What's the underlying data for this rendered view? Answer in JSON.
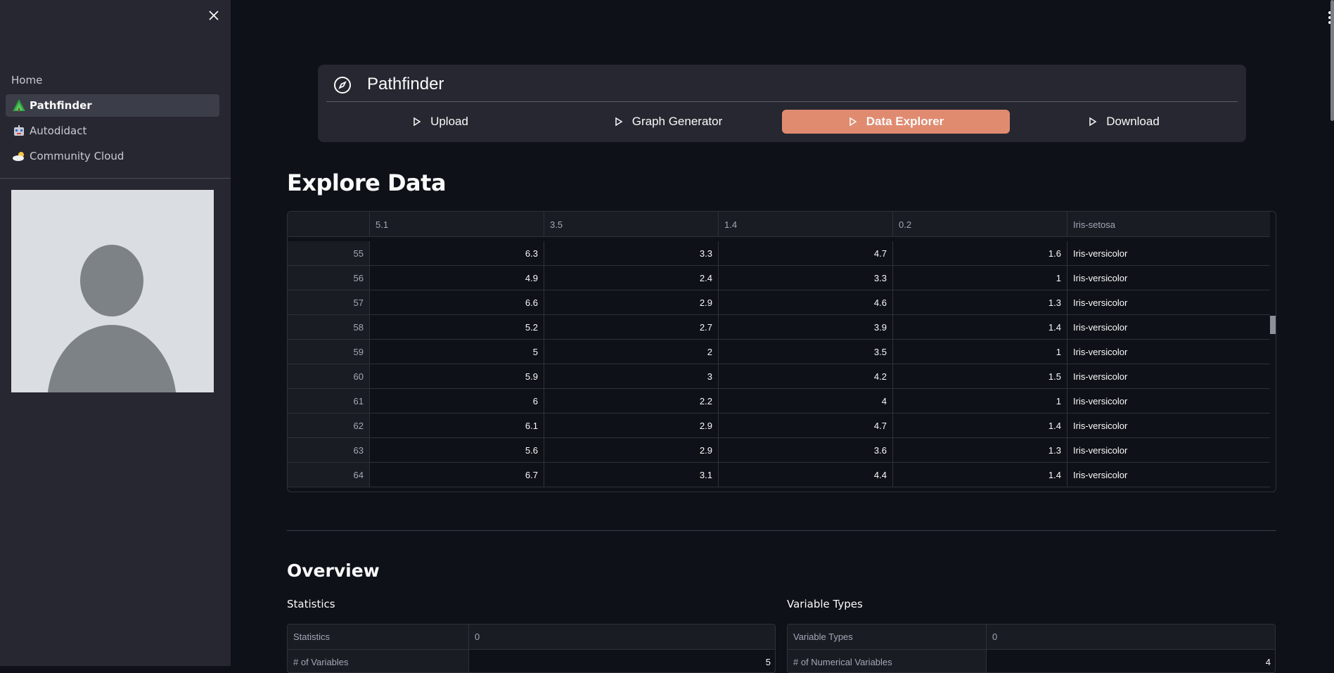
{
  "sidebar": {
    "close_icon": "close-icon",
    "items": [
      {
        "label": "Home",
        "icon": "",
        "active": false
      },
      {
        "label": "Pathfinder",
        "icon": "tree-icon",
        "active": true
      },
      {
        "label": "Autodidact",
        "icon": "robot-icon",
        "active": false
      },
      {
        "label": "Community Cloud",
        "icon": "cloud-sun-icon",
        "active": false
      }
    ],
    "avatar_icon": "user-avatar-icon"
  },
  "nav": {
    "title": "Pathfinder",
    "icon": "compass-icon",
    "tabs": [
      {
        "label": "Upload",
        "active": false
      },
      {
        "label": "Graph Generator",
        "active": false
      },
      {
        "label": "Data Explorer",
        "active": true
      },
      {
        "label": "Download",
        "active": false
      }
    ],
    "accent_color": "#e08b70"
  },
  "explore": {
    "title": "Explore Data",
    "columns": [
      "",
      "5.1",
      "3.5",
      "1.4",
      "0.2",
      "Iris-setosa"
    ],
    "rows": [
      [
        "55",
        "6.3",
        "3.3",
        "4.7",
        "1.6",
        "Iris-versicolor"
      ],
      [
        "56",
        "4.9",
        "2.4",
        "3.3",
        "1",
        "Iris-versicolor"
      ],
      [
        "57",
        "6.6",
        "2.9",
        "4.6",
        "1.3",
        "Iris-versicolor"
      ],
      [
        "58",
        "5.2",
        "2.7",
        "3.9",
        "1.4",
        "Iris-versicolor"
      ],
      [
        "59",
        "5",
        "2",
        "3.5",
        "1",
        "Iris-versicolor"
      ],
      [
        "60",
        "5.9",
        "3",
        "4.2",
        "1.5",
        "Iris-versicolor"
      ],
      [
        "61",
        "6",
        "2.2",
        "4",
        "1",
        "Iris-versicolor"
      ],
      [
        "62",
        "6.1",
        "2.9",
        "4.7",
        "1.4",
        "Iris-versicolor"
      ],
      [
        "63",
        "5.6",
        "2.9",
        "3.6",
        "1.3",
        "Iris-versicolor"
      ],
      [
        "64",
        "6.7",
        "3.1",
        "4.4",
        "1.4",
        "Iris-versicolor"
      ]
    ]
  },
  "overview": {
    "title": "Overview",
    "statistics": {
      "label": "Statistics",
      "header": [
        "Statistics",
        "0"
      ],
      "rows": [
        [
          "# of Variables",
          "5"
        ]
      ]
    },
    "variable_types": {
      "label": "Variable Types",
      "header": [
        "Variable Types",
        "0"
      ],
      "rows": [
        [
          "# of Numerical Variables",
          "4"
        ]
      ]
    }
  }
}
